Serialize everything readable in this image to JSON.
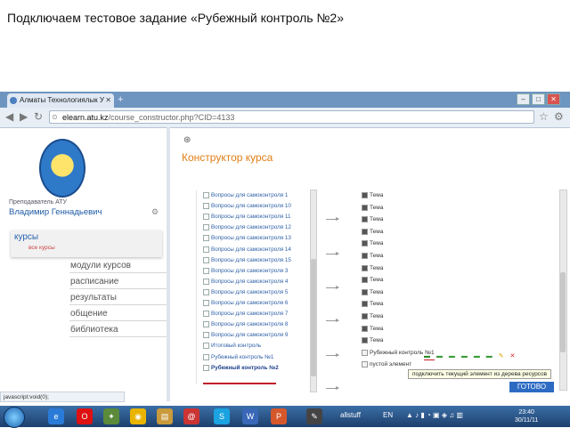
{
  "slide": {
    "title": "Подключаем тестовое задание «Рубежный контроль №2»"
  },
  "browser": {
    "tab_title": "Алматы Технологиялык У",
    "address_host": "elearn.atu.kz",
    "address_path": "/course_constructor.php?CID=4133",
    "status_text": "javascript:void(0);"
  },
  "sidebar": {
    "role": "Преподаватель АТУ",
    "user_name": "Владимир Геннадьевич",
    "courses_label": "курсы",
    "courses_sub": "все курсы",
    "menu": [
      "модули курсов",
      "расписание",
      "результаты",
      "общение",
      "библиотека"
    ]
  },
  "constructor": {
    "heading": "Конструктор курса",
    "left_items": [
      "Вопросы для самоконтроля 1",
      "Вопросы для самоконтроля 10",
      "Вопросы для самоконтроля 11",
      "Вопросы для самоконтроля 12",
      "Вопросы для самоконтроля 13",
      "Вопросы для самоконтроля 14",
      "Вопросы для самоконтроля 15",
      "Вопросы для самоконтроля 3",
      "Вопросы для самоконтроля 4",
      "Вопросы для самоконтроля 5",
      "Вопросы для самоконтроля 6",
      "Вопросы для самоконтроля 7",
      "Вопросы для самоконтроля 8",
      "Вопросы для самоконтроля 9",
      "Итоговый контроль",
      "Рубежный контроль №1",
      "Рубежный контроль №2"
    ],
    "right_items": [
      "Тема",
      "Тема",
      "Тема",
      "Тема",
      "Тема",
      "Тема",
      "Тема",
      "Тема",
      "Тема",
      "Тема",
      "Тема",
      "Тема",
      "Тема",
      "Рубежный контроль №1",
      "пустой элемент"
    ],
    "tooltip": "подключить текущий элемент из дерева ресурсов",
    "done_button": "ГОТОВО"
  },
  "taskbar": {
    "app_label": "allstuff",
    "lang": "EN",
    "time": "23:40",
    "date": "30/11/11"
  },
  "colors": {
    "accent": "#e07f16",
    "link": "#2d5fa7",
    "taskbar": "#1d3f6d"
  }
}
